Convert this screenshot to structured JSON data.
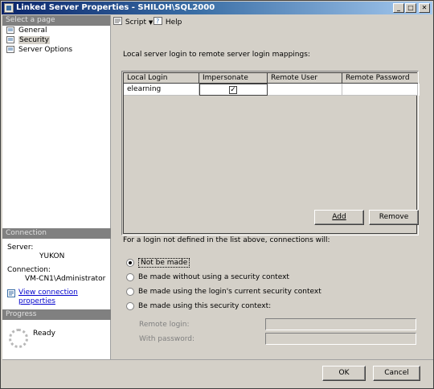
{
  "window": {
    "title": "Linked Server Properties - SHILOH\\SQL2000"
  },
  "left": {
    "select_page_header": "Select a page",
    "items": [
      {
        "label": "General",
        "icon": "page-icon"
      },
      {
        "label": "Security",
        "icon": "page-icon"
      },
      {
        "label": "Server Options",
        "icon": "page-icon"
      }
    ],
    "connection_header": "Connection",
    "server_label": "Server:",
    "server_value": "YUKON",
    "connection_label": "Connection:",
    "connection_value": "VM-CN1\\Administrator",
    "view_link": "View connection properties",
    "progress_header": "Progress",
    "progress_status": "Ready"
  },
  "toolbar": {
    "script_label": "Script",
    "help_label": "Help"
  },
  "main": {
    "caption": "Local server login to remote server login mappings:",
    "grid": {
      "columns": [
        "Local Login",
        "Impersonate",
        "Remote User",
        "Remote Password"
      ],
      "rows": [
        {
          "local_login": "elearning",
          "impersonate": true,
          "remote_user": "",
          "remote_password": ""
        }
      ]
    },
    "add_label": "Add",
    "remove_label": "Remove",
    "question": "For a login not defined in the list above, connections will:",
    "options": [
      {
        "label": "Not be made",
        "selected": true
      },
      {
        "label": "Be made without using a security context",
        "selected": false
      },
      {
        "label": "Be made using the login's current security context",
        "selected": false
      },
      {
        "label": "Be made using this security context:",
        "selected": false
      }
    ],
    "remote_login_label": "Remote login:",
    "remote_login_value": "",
    "password_label": "With password:",
    "password_value": ""
  },
  "footer": {
    "ok_label": "OK",
    "cancel_label": "Cancel"
  }
}
